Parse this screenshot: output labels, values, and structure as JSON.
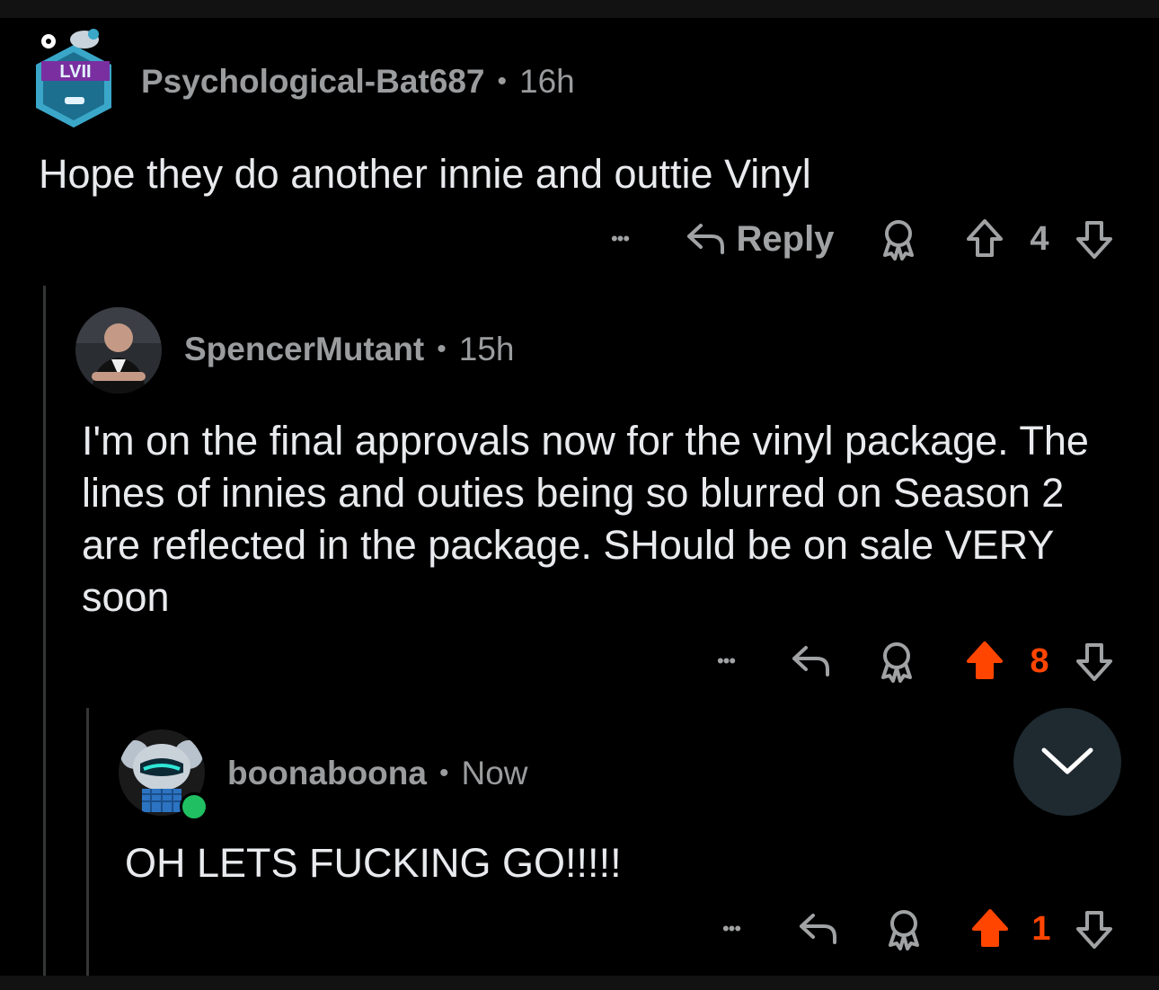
{
  "comments": [
    {
      "username": "Psychological-Bat687",
      "time": "16h",
      "body": "Hope they do another innie and outtie Vinyl",
      "reply_label": "Reply",
      "score": "4",
      "upvoted": false
    },
    {
      "username": "SpencerMutant",
      "time": "15h",
      "body": "I'm on the final approvals now for the vinyl package. The lines of innies and outies being so blurred on Season 2 are reflected in the package. SHould be on sale VERY soon",
      "score": "8",
      "upvoted": true
    },
    {
      "username": "boonaboona",
      "time": "Now",
      "body": "OH LETS FUCKING GO!!!!!",
      "score": "1",
      "upvoted": true,
      "online": true
    }
  ],
  "separator": "•",
  "more_label": "•••",
  "colors": {
    "background": "#000000",
    "upvote": "#ff4500",
    "muted": "#9a9c9e",
    "online": "#1fbf62",
    "fab": "#1e2a30"
  },
  "icons": [
    "reply-arrow-icon",
    "award-icon",
    "upvote-icon",
    "downvote-icon",
    "chevron-down-icon",
    "more-icon"
  ]
}
